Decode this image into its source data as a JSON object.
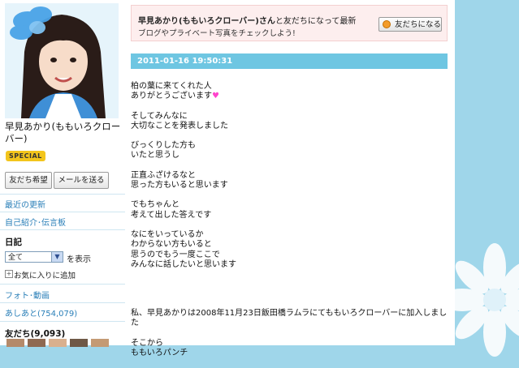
{
  "sidebar": {
    "profile_name": "早見あかり(ももいろクローバー)",
    "badge": "SPECIAL",
    "friend_request_button": "友だち希望",
    "send_mail_button": "メールを送る",
    "links": {
      "recent_updates": "最近の更新",
      "self_intro": "自己紹介･伝言板",
      "photo_video": "フォト･動画",
      "footprints": "あしあと(754,079)"
    },
    "diary": {
      "title": "日記",
      "select_value": "全て",
      "show_label": "を表示",
      "favorite_label": "お気に入りに追加"
    },
    "friends_title": "友だち(9,093)"
  },
  "notice": {
    "name": "早見あかり(ももいろクローバー)さん",
    "line1_suffix": "と友だちになって最新",
    "line2": "ブログやプライベート写真をチェックしよう!",
    "button_label": "友だちになる"
  },
  "post": {
    "datetime": "2011-01-16 19:50:31",
    "p1_line1": "柏の葉に来てくれた人",
    "p1_line2": "ありがとうございます",
    "p2": "そしてみんなに\n大切なことを発表しました",
    "p3": "びっくりした方も\nいたと思うし",
    "p4": "正直ふざけるなと\n思った方もいると思います",
    "p5": "でもちゃんと\n考えて出した答えです",
    "p6": "なにをいっているか\nわからない方もいると\n思うのでもう一度ここで\nみんなに話したいと思います",
    "p7": "私、早見あかりは2008年11月23日飯田橋ラムラにてももいろクローバーに加入しました",
    "p8": "そこから\nももいろパンチ"
  },
  "colors": {
    "date_bar": "#6ec6e2",
    "notice_bg": "#fdeeee",
    "badge": "#f3c51c",
    "link": "#2a7fb8",
    "page_side_bg": "#9fd6ea"
  }
}
